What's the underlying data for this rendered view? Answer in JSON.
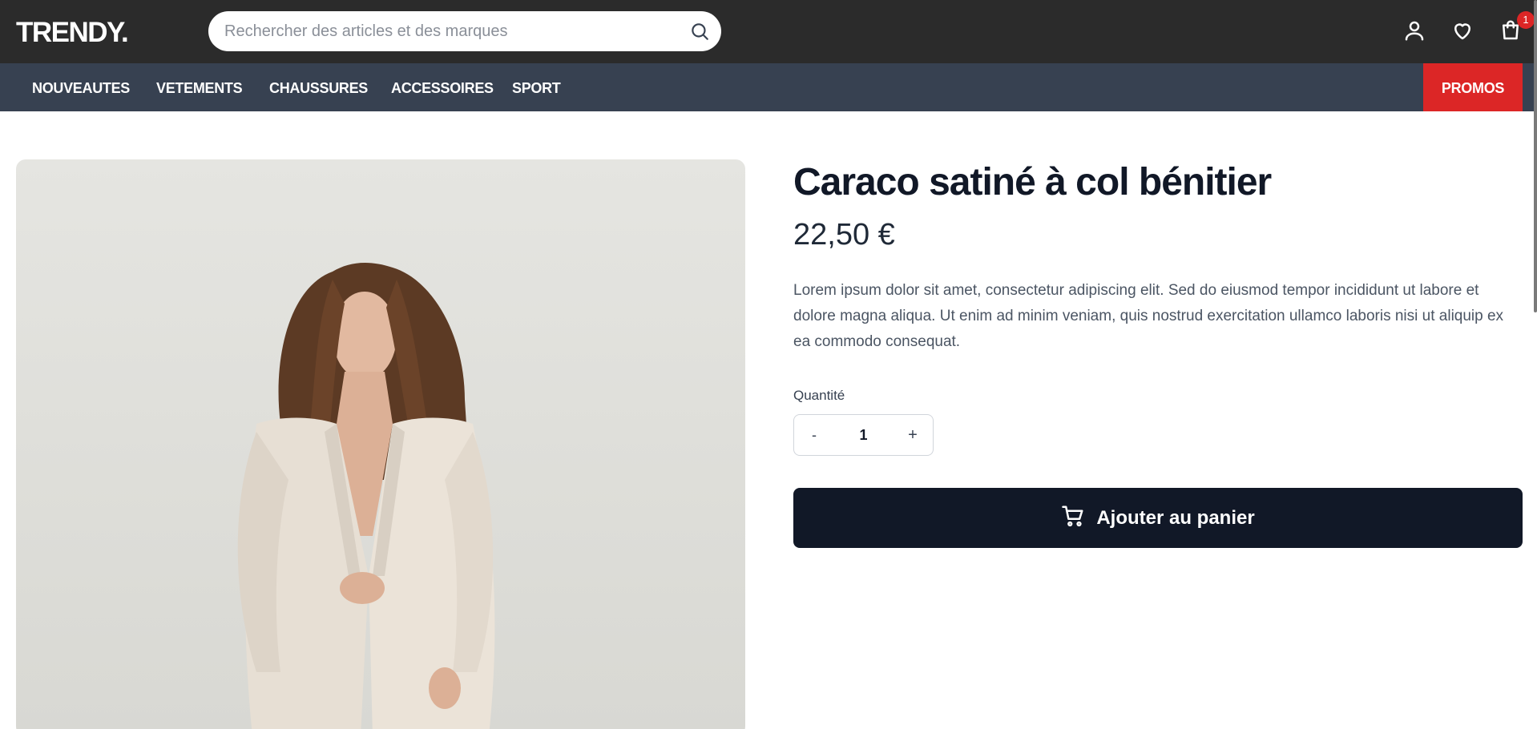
{
  "header": {
    "logo": "TRENDY.",
    "search_placeholder": "Rechercher des articles et des marques",
    "icons": [
      "search-icon",
      "user-icon",
      "heart-icon",
      "shopping-bag-icon"
    ],
    "cart_count": "1"
  },
  "nav": {
    "items": [
      {
        "label": "NOUVEAUTES"
      },
      {
        "label": "VETEMENTS"
      },
      {
        "label": "CHAUSSURES"
      },
      {
        "label": "ACCESSOIRES"
      },
      {
        "label": "SPORT"
      }
    ],
    "promo_label": "PROMOS"
  },
  "product": {
    "title": "Caraco satiné à col bénitier",
    "price": "22,50 €",
    "description": "Lorem ipsum dolor sit amet, consectetur adipiscing elit. Sed do eiusmod tempor incididunt ut labore et dolore magna aliqua. Ut enim ad minim veniam, quis nostrud exercitation ullamco laboris nisi ut aliquip ex ea commodo consequat.",
    "quantity_label": "Quantité",
    "quantity_minus": "-",
    "quantity_value": "1",
    "quantity_plus": "+",
    "add_to_cart_label": "Ajouter au panier",
    "add_to_cart_icon": "cart-icon"
  },
  "colors": {
    "topbar": "#2b2b2b",
    "navbar": "#374151",
    "promo": "#dc2626",
    "button": "#111827"
  }
}
